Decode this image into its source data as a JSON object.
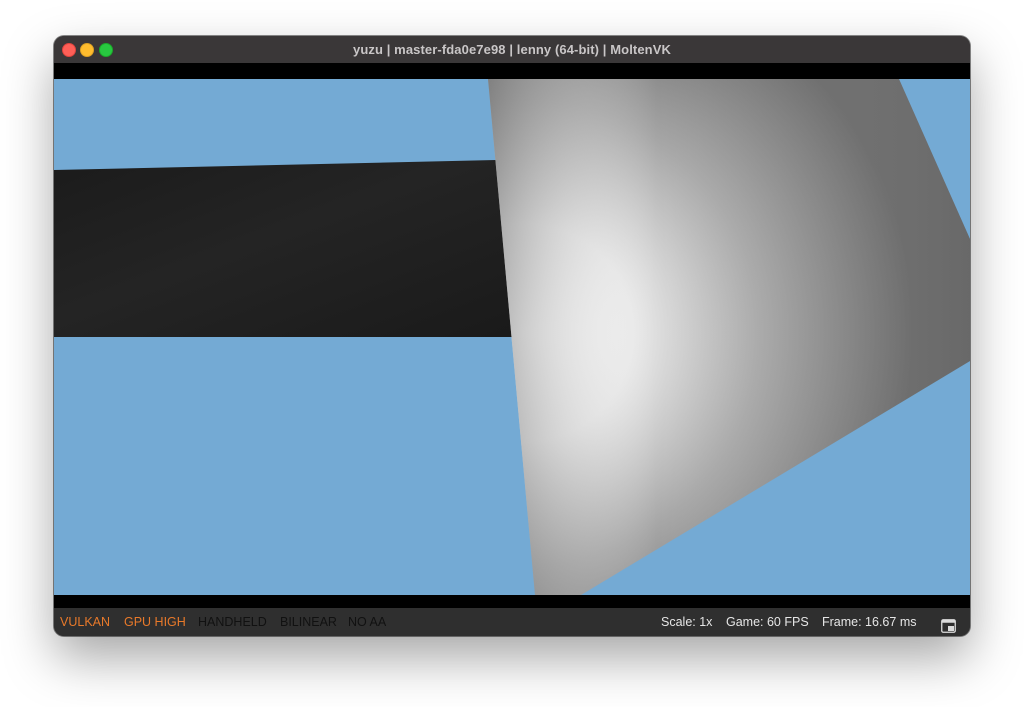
{
  "window": {
    "title": "yuzu | master-fda0e7e98 | lenny (64-bit) | MoltenVK"
  },
  "statusbar": {
    "renderer": "VULKAN",
    "gpu_accuracy": "GPU HIGH",
    "dock_mode": "HANDHELD",
    "filter": "BILINEAR",
    "aa": "NO AA",
    "scale": "Scale: 1x",
    "game_fps": "Game: 60 FPS",
    "frame_time": "Frame: 16.67 ms",
    "dock_icon": "window-icon"
  },
  "colors": {
    "sky": "#74aad4",
    "orange": "#e8792a",
    "statusbar_bg": "#2f2f2f",
    "titlebar_bg": "#3a3738"
  }
}
